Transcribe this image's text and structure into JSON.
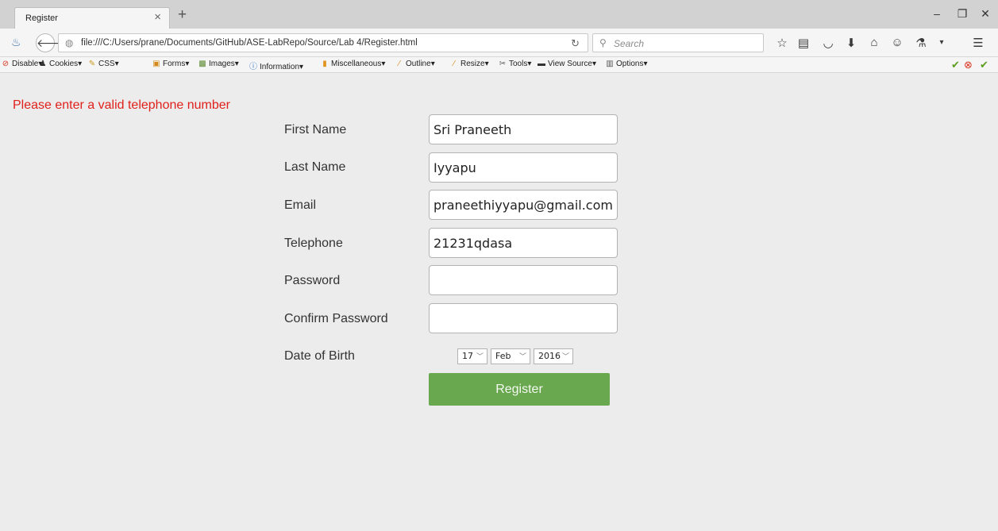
{
  "browser": {
    "tab_title": "Register",
    "tab_close": "×",
    "new_tab": "+",
    "window_controls": {
      "minimize": "–",
      "maximize": "❐",
      "close": "✕"
    },
    "url": "file:///C:/Users/prane/Documents/GitHub/ASE-LabRepo/Source/Lab 4/Register.html",
    "search_placeholder": "Search",
    "toolbar_icons": [
      "star-icon",
      "reading-list-icon",
      "pocket-icon",
      "download-icon",
      "home-icon",
      "chat-icon",
      "extension-icon",
      "menu-icon"
    ]
  },
  "devtoolbar": {
    "items": [
      "Disable",
      "Cookies",
      "CSS",
      "Forms",
      "Images",
      "Information",
      "Miscellaneous",
      "Outline",
      "Resize",
      "Tools",
      "View Source",
      "Options"
    ]
  },
  "page": {
    "error": "Please enter a valid telephone number",
    "labels": {
      "first_name": "First Name",
      "last_name": "Last Name",
      "email": "Email",
      "telephone": "Telephone",
      "password": "Password",
      "confirm_password": "Confirm Password",
      "dob": "Date of Birth"
    },
    "values": {
      "first_name": "Sri Praneeth",
      "last_name": "Iyyapu",
      "email": "praneethiyyapu@gmail.com",
      "telephone": "21231qdasa",
      "password": "",
      "confirm_password": ""
    },
    "dob": {
      "day": "17",
      "month": "Feb",
      "year": "2016"
    },
    "register_label": "Register"
  },
  "colors": {
    "error": "#e0201a",
    "button": "#6aa84f",
    "page_bg": "#ececec"
  }
}
